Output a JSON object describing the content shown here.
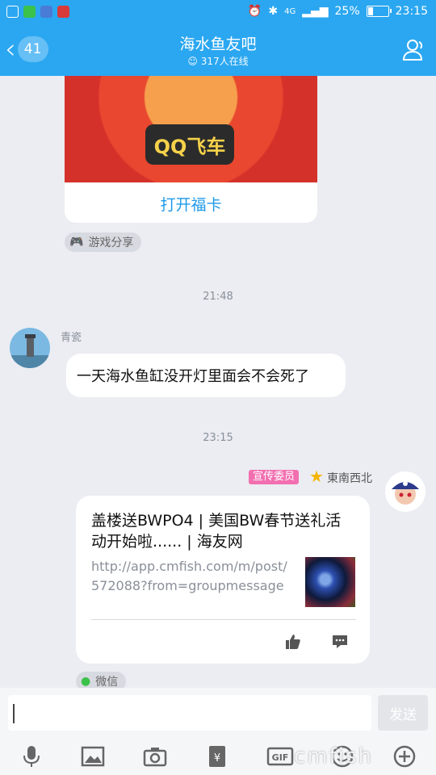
{
  "status_bar": {
    "battery_percent": "25%",
    "battery_level": 0.25,
    "time": "23:15",
    "network": "4G"
  },
  "header": {
    "back_count": "41",
    "title": "海水鱼友吧",
    "online": "317人在线"
  },
  "card": {
    "logo_text": "QQ飞车",
    "open_label": "打开福卡",
    "source_label": "游戏分享"
  },
  "messages": [
    {
      "time": "21:48",
      "sender": "青瓷",
      "text": "一天海水鱼缸没开灯里面会不会死了"
    },
    {
      "time": "23:15",
      "role_badge": "宣传委员",
      "sender": "東南西北",
      "link_title": "盖楼送BWPO4 | 美国BW春节送礼活动开始啦...... | 海友网",
      "link_url": "http://app.cmfish.com/m/post/572088?from=groupmessage",
      "source_label": "微信"
    }
  ],
  "input": {
    "placeholder": "",
    "send_label": "发送"
  },
  "toolbar": {
    "icons": [
      "mic-icon",
      "image-icon",
      "camera-icon",
      "red-packet-icon",
      "gif-icon",
      "emoji-icon",
      "plus-icon"
    ]
  },
  "watermark": "cmfish",
  "colors": {
    "brand": "#2ba7f1",
    "link": "#1e9ae8",
    "role_badge": "#f26fb0"
  }
}
